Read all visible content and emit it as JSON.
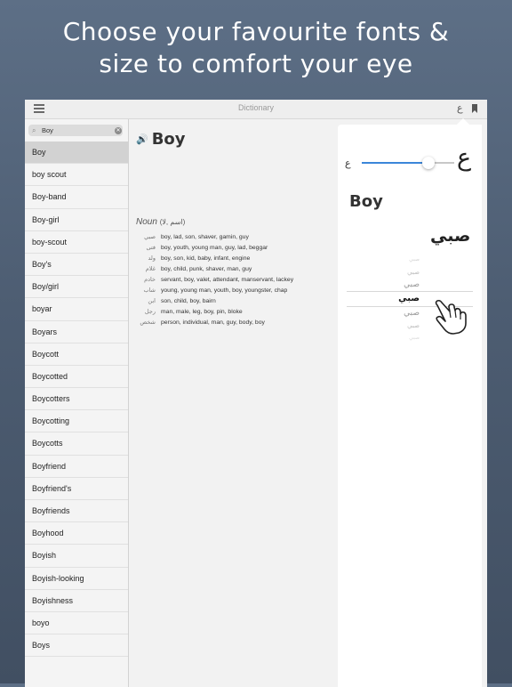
{
  "headline": {
    "line1": "Choose your favourite fonts &",
    "line2": "size to comfort your eye"
  },
  "topbar": {
    "title": "Dictionary",
    "menu_icon": "hamburger-menu-icon",
    "font_icon": "arabic-font-icon",
    "font_icon_glyph": "ع",
    "bookmark_icon": "bookmark-icon"
  },
  "search": {
    "value": "Boy",
    "search_icon_glyph": "⌕",
    "clear_glyph": "✕"
  },
  "word_list": [
    "Boy",
    "boy scout",
    "Boy-band",
    "Boy-girl",
    "boy-scout",
    "Boy's",
    "Boy/girl",
    "boyar",
    "Boyars",
    "Boycott",
    "Boycotted",
    "Boycotters",
    "Boycotting",
    "Boycotts",
    "Boyfriend",
    "Boyfriend's",
    "Boyfriends",
    "Boyhood",
    "Boyish",
    "Boyish-looking",
    "Boyishness",
    "boyo",
    "Boys"
  ],
  "entry": {
    "speaker_glyph": "🔊",
    "word": "Boy",
    "pos": "Noun",
    "pos_ar": "(اسم ,لا)",
    "definitions": [
      {
        "ar": "صبي",
        "en": "boy, lad, son, shaver, gamin, guy"
      },
      {
        "ar": "فتى",
        "en": "boy, youth, young man, guy, lad, beggar"
      },
      {
        "ar": "ولد",
        "en": "boy, son, kid, baby, infant, engine"
      },
      {
        "ar": "غلام",
        "en": "boy, child, punk, shaver, man, guy"
      },
      {
        "ar": "خادم",
        "en": "servant, boy, valet, attendant, manservant, lackey"
      },
      {
        "ar": "شاب",
        "en": "young, young man, youth, boy, youngster, chap"
      },
      {
        "ar": "ابن",
        "en": "son, child, boy, bairn"
      },
      {
        "ar": "رجل",
        "en": "man, male, leg, boy, pin, bloke"
      },
      {
        "ar": "شخص",
        "en": "person, individual, man, guy, body, boy"
      }
    ]
  },
  "font_panel": {
    "small_glyph": "ع",
    "large_glyph": "ع",
    "font_size_level": 0.72,
    "accent_color": "#3b86d9",
    "preview_word": "Boy",
    "preview_arabic": "صبي",
    "font_options": [
      "صبي",
      "صبي",
      "صبي",
      "صبي",
      "صبي",
      "صبي",
      "صبي"
    ],
    "hand_icon": "pointing-hand-icon"
  }
}
